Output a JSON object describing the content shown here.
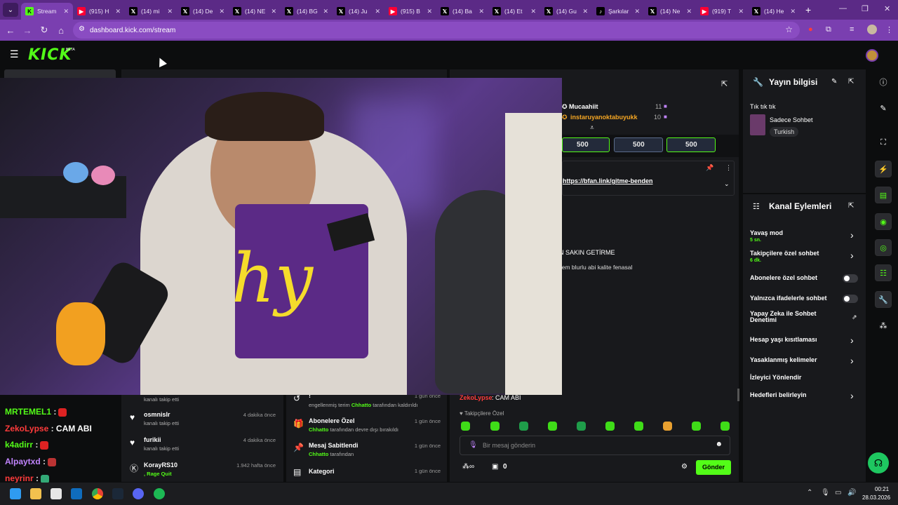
{
  "browser": {
    "tabs": [
      {
        "label": "Stream",
        "icon": "kick-icon",
        "color": "#53fc18"
      },
      {
        "label": "(915) H",
        "icon": "youtube-icon",
        "color": "#ff0033"
      },
      {
        "label": "(14) mi",
        "icon": "x-icon",
        "color": "#000000"
      },
      {
        "label": "(14) De",
        "icon": "x-icon",
        "color": "#000000"
      },
      {
        "label": "(14) NE",
        "icon": "x-icon",
        "color": "#000000"
      },
      {
        "label": "(14) BG",
        "icon": "x-icon",
        "color": "#000000"
      },
      {
        "label": "(14) Ju",
        "icon": "x-icon",
        "color": "#000000"
      },
      {
        "label": "(915) B",
        "icon": "youtube-icon",
        "color": "#ff0033"
      },
      {
        "label": "(14) Ba",
        "icon": "x-icon",
        "color": "#000000"
      },
      {
        "label": "(14) Et",
        "icon": "x-icon",
        "color": "#000000"
      },
      {
        "label": "(14) Gu",
        "icon": "x-icon",
        "color": "#000000"
      },
      {
        "label": "Şarkılar",
        "icon": "tiktok-icon",
        "color": "#000000"
      },
      {
        "label": "(14) Ne",
        "icon": "x-icon",
        "color": "#000000"
      },
      {
        "label": "(919) T",
        "icon": "youtube-icon",
        "color": "#ff0033"
      },
      {
        "label": "(14) He",
        "icon": "x-icon",
        "color": "#000000"
      }
    ],
    "new_tab": "+",
    "url": "dashboard.kick.com/stream"
  },
  "header": {
    "logo": "KICK",
    "beta": "BETA"
  },
  "top_chatters": [
    {
      "name": "Mucaahiit",
      "count": "11"
    },
    {
      "name": "instaruyanoktabuyukk",
      "count": "10"
    }
  ],
  "gift_pills": [
    "500",
    "500",
    "500"
  ],
  "pinned_link": "https://bfan.link/gitme-benden",
  "chat_fragments": [
    "AN SAKIN GETİRME",
    "hem blurlu abi kalite fenasal"
  ],
  "stream_info": {
    "title": "Yayın bilgisi",
    "stream_title": "Tık tık tık",
    "category": "Sadece Sohbet",
    "language": "Turkish"
  },
  "channel_actions": {
    "title": "Kanal Eylemleri",
    "items": [
      {
        "label": "Yavaş mod",
        "sub": "5 sn."
      },
      {
        "label": "Takipçilere özel sohbet",
        "sub": "6 dk."
      },
      {
        "label": "Abonelere özel sohbet",
        "sub": ""
      },
      {
        "label": "Yalnızca ifadelerle sohbet",
        "sub": ""
      },
      {
        "label": "Yapay Zeka ile Sohbet Denetimi",
        "sub": ""
      },
      {
        "label": "Hesap yaşı kısıtlaması",
        "sub": ""
      },
      {
        "label": "Yasaklanmış kelimeler",
        "sub": ""
      },
      {
        "label": "İzleyici Yönlendir",
        "sub": ""
      },
      {
        "label": "Hedefleri belirleyin",
        "sub": ""
      }
    ]
  },
  "left_chat": [
    {
      "user": "MRTEMEL1",
      "text": "",
      "color": "#53fc18"
    },
    {
      "user": "ZekoLypse",
      "text": "CAM ABI",
      "color": "#ff3b3b"
    },
    {
      "user": "k4adirr",
      "text": "",
      "color": "#53fc18"
    },
    {
      "user": "Alpaytxd",
      "text": "",
      "color": "#c084fc"
    },
    {
      "user": "neyrinr",
      "text": "",
      "color": "#ff3b3b"
    }
  ],
  "follow_feed": [
    {
      "name": "",
      "sub": "kanalı takip etti",
      "time": ""
    },
    {
      "name": "osmnisIr",
      "sub": "kanalı takip etti",
      "time": "4 dakika önce"
    },
    {
      "name": "furikii",
      "sub": "kanalı takip etti",
      "time": "4 dakika önce"
    },
    {
      "name": "KorayRS10",
      "sub": ", Rage Quit",
      "time": "1.942 hafta önce"
    }
  ],
  "mod_feed": [
    {
      "title": "!",
      "sub_pre": "engellenmiş terim",
      "user": "Chhatto",
      "sub_post": "tarafından kaldırıldı",
      "time": "1 gün önce"
    },
    {
      "title": "Abonelere Özel",
      "sub_pre": "",
      "user": "Chhatto",
      "sub_post": "tarafından devre dışı bırakıldı",
      "time": "1 gün önce"
    },
    {
      "title": "Mesaj Sabitlendi",
      "sub_pre": "",
      "user": "Chhatto",
      "sub_post": "tarafından",
      "time": "1 gün önce"
    },
    {
      "title": "Kategori",
      "sub_pre": "",
      "user": "",
      "sub_post": "",
      "time": "1 gün önce"
    }
  ],
  "chat_panel": {
    "last_user": "ZekoLypse",
    "last_text": ": CAM ABI",
    "followers_only": "Takipçilere Özel",
    "placeholder": "Bir mesaj gönderin",
    "viewer_count": "0",
    "send": "Gönder"
  },
  "taskbar": {
    "time": "00:21",
    "date": "28.03.2026"
  },
  "colors": {
    "accent": "#53fc18",
    "browser": "#7a3fb0"
  }
}
